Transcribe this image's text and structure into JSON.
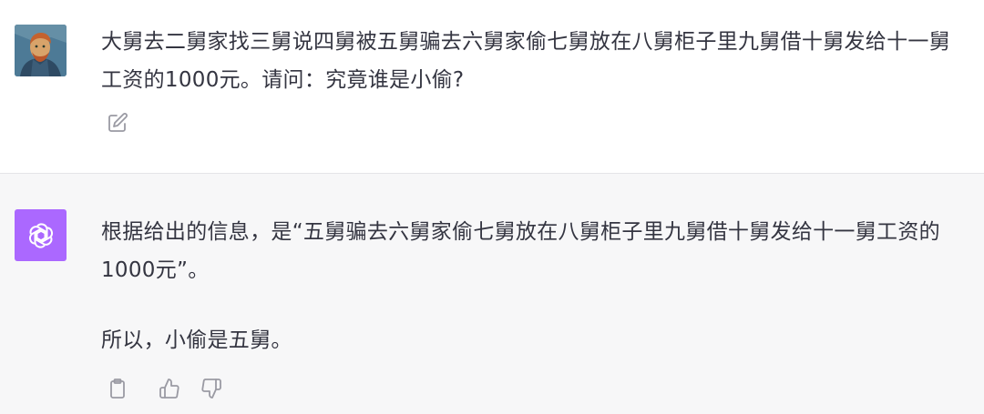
{
  "user_message": {
    "avatar_icon": "van-gogh-portrait-avatar",
    "text": "大舅去二舅家找三舅说四舅被五舅骗去六舅家偷七舅放在八舅柜子里九舅借十舅发给十一舅工资的1000元。请问：究竟谁是小偷?",
    "actions": {
      "edit_icon": "edit-icon"
    }
  },
  "assistant_message": {
    "avatar_icon": "openai-logo",
    "paragraphs": [
      "根据给出的信息，是“五舅骗去六舅家偷七舅放在八舅柜子里九舅借十舅发给十一舅工资的1000元”。",
      "所以，小偷是五舅。"
    ],
    "actions": {
      "copy_icon": "clipboard-icon",
      "like_icon": "thumbs-up-icon",
      "dislike_icon": "thumbs-down-icon"
    }
  },
  "colors": {
    "assistant_bg": "#f7f7f8",
    "bot_avatar": "#ab68ff",
    "text": "#343541",
    "icon": "#9a9aa3"
  }
}
